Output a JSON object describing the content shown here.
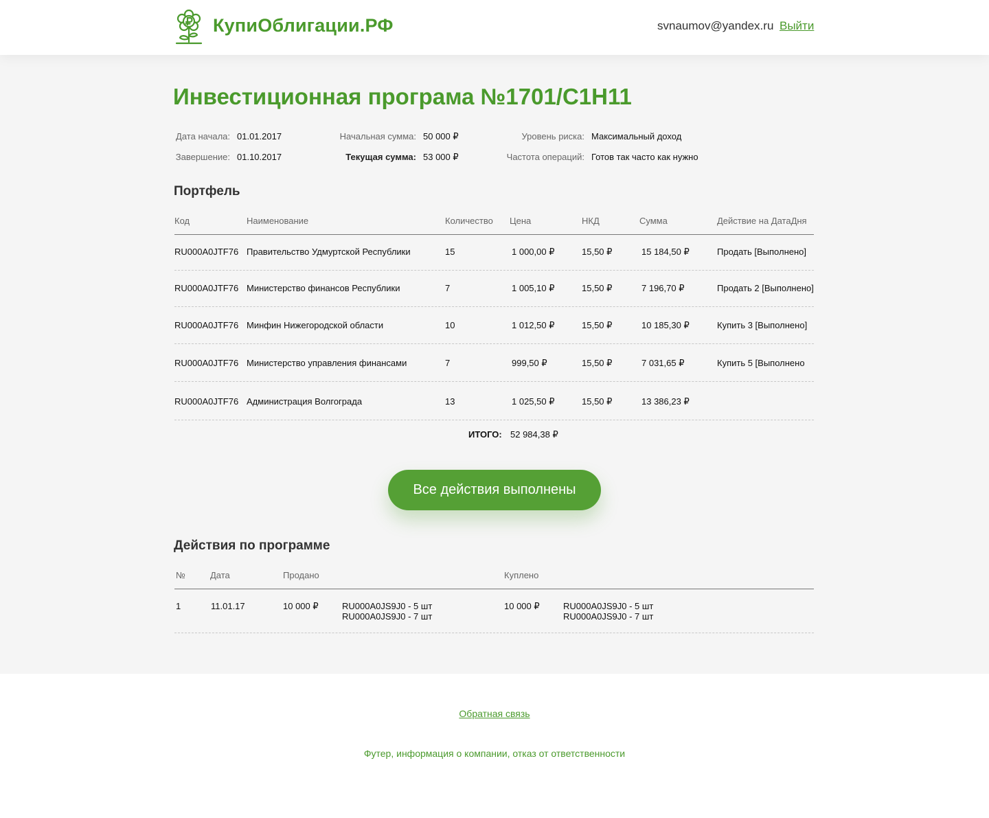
{
  "header": {
    "logo_text": "КупиОблигации.РФ",
    "user_email": "svnaumov@yandex.ru",
    "logout_label": "Выйти"
  },
  "page": {
    "title": "Инвестиционная програма №1701/С1Н11"
  },
  "info": {
    "start_date_label": "Дата начала:",
    "start_date": "01.01.2017",
    "end_date_label": "Завершение:",
    "end_date": "01.10.2017",
    "initial_sum_label": "Начальная сумма:",
    "initial_sum": "50 000 ₽",
    "current_sum_label": "Текущая сумма:",
    "current_sum": "53 000 ₽",
    "risk_label": "Уровень риска:",
    "risk": "Максимальный доход",
    "frequency_label": "Частота операций:",
    "frequency": "Готов так часто как нужно"
  },
  "portfolio": {
    "title": "Портфель",
    "headers": [
      "Код",
      "Наименование",
      "Количество",
      "Цена",
      "НКД",
      "Сумма",
      "Действие на ДатаДня"
    ],
    "rows": [
      {
        "code": "RU000A0JTF76",
        "name": "Правительство Удмуртской Республики",
        "qty": "15",
        "price": "1 000,00 ₽",
        "nkd": "15,50 ₽",
        "sum": "15 184,50 ₽",
        "action": "Продать [Выполнено]"
      },
      {
        "code": "RU000A0JTF76",
        "name": "Министерство финансов Республики",
        "qty": "7",
        "price": "1 005,10 ₽",
        "nkd": "15,50 ₽",
        "sum": "7 196,70 ₽",
        "action": "Продать 2 [Выполнено]"
      },
      {
        "code": "RU000A0JTF76",
        "name": "Минфин Нижегородской области",
        "qty": "10",
        "price": "1 012,50 ₽",
        "nkd": "15,50 ₽",
        "sum": "10 185,30 ₽",
        "action": "Купить 3 [Выполнено]"
      },
      {
        "code": "RU000A0JTF76",
        "name": "Министерство управления финансами",
        "qty": "7",
        "price": "999,50 ₽",
        "nkd": "15,50 ₽",
        "sum": "7 031,65 ₽",
        "action": "Купить 5 [Выполнено"
      },
      {
        "code": "RU000A0JTF76",
        "name": "Администрация Волгограда",
        "qty": "13",
        "price": "1 025,50 ₽",
        "nkd": "15,50 ₽",
        "sum": "13 386,23 ₽",
        "action": ""
      }
    ],
    "total_label": "ИТОГО:",
    "total_value": "52 984,38 ₽"
  },
  "status_button": "Все действия выполнены",
  "actions": {
    "title": "Действия по программе",
    "headers": [
      "№",
      "Дата",
      "Продано",
      "Куплено"
    ],
    "rows": [
      {
        "num": "1",
        "date": "11.01.17",
        "sold_sum": "10 000 ₽",
        "sold_items": [
          "RU000A0JS9J0 - 5 шт",
          "RU000A0JS9J0 - 7 шт"
        ],
        "bought_sum": "10 000 ₽",
        "bought_items": [
          "RU000A0JS9J0 - 5 шт",
          "RU000A0JS9J0 - 7 шт"
        ]
      }
    ]
  },
  "footer": {
    "feedback": "Обратная связь",
    "info": "Футер, информация о компании, отказ от ответственности"
  },
  "colors": {
    "brand_green": "#4a9a2c",
    "button_green": "#55a035",
    "page_bg": "#f5f5f5"
  },
  "icons": {
    "logo": "flower-ruble-icon"
  }
}
